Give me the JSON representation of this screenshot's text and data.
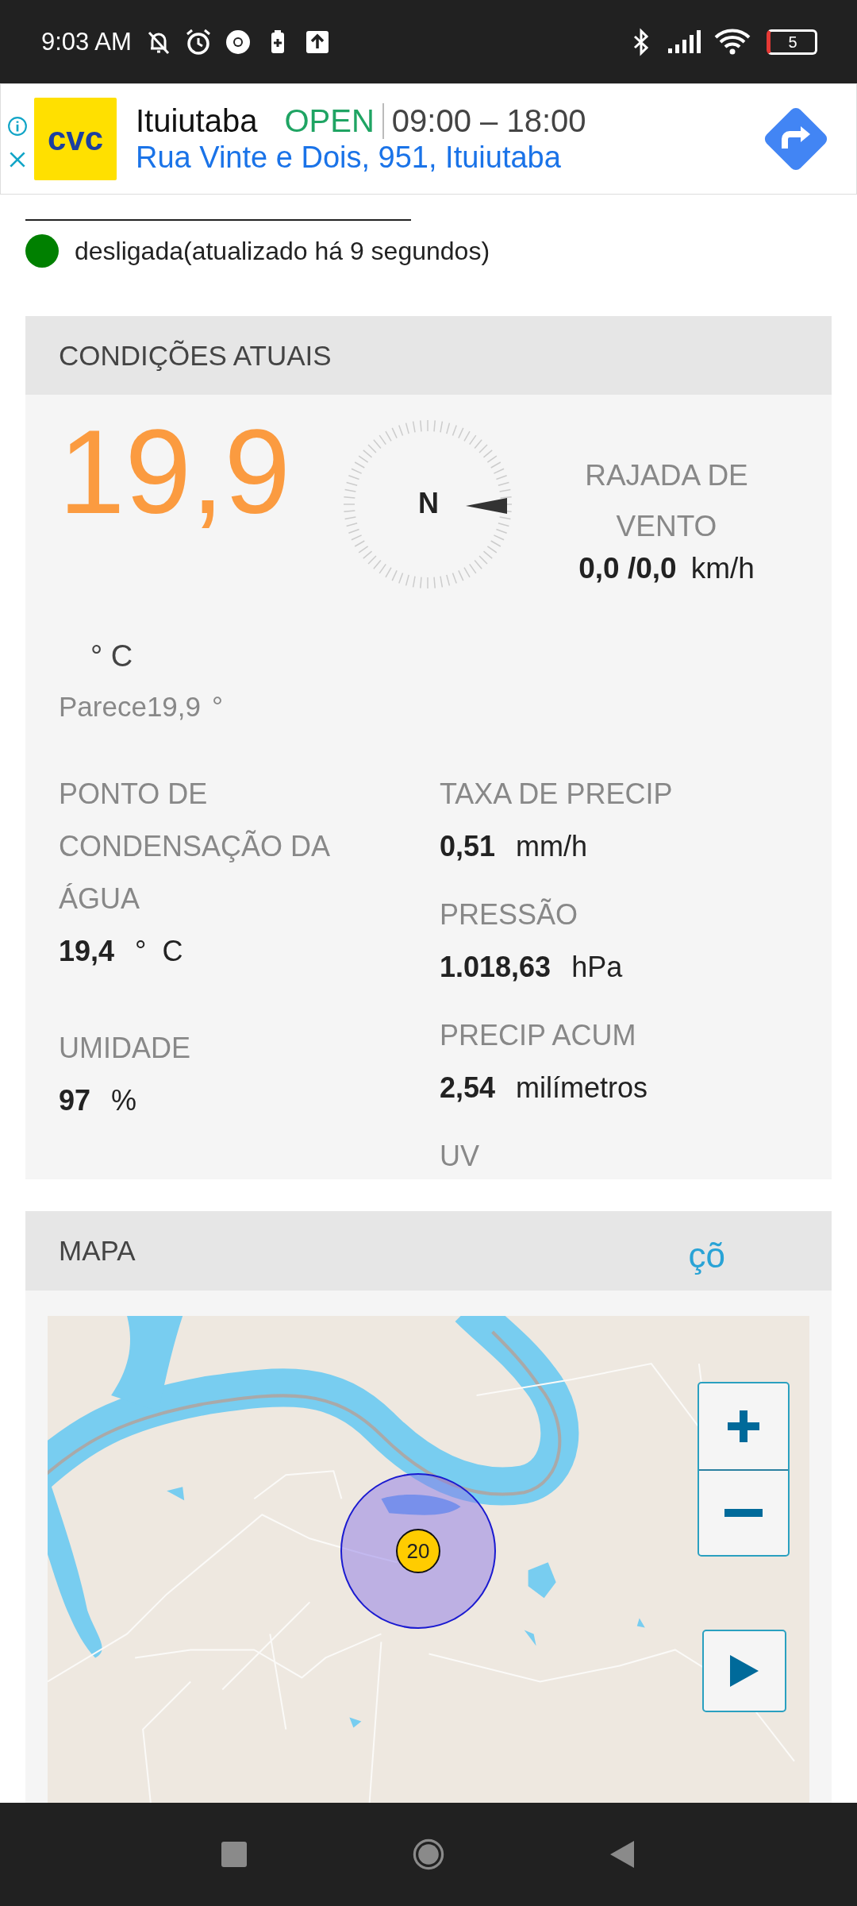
{
  "status_bar": {
    "time": "9:03 AM",
    "battery": "5"
  },
  "ad": {
    "logo": "cvc",
    "title": "Ituiutaba",
    "status": "OPEN",
    "hours": "09:00 – 18:00",
    "address": "Rua Vinte e Dois, 951, Ituiutaba"
  },
  "station": {
    "status": "desligada(atualizado há 9 segundos)",
    "color": "#008000"
  },
  "current": {
    "title": "CONDIÇÕES ATUAIS",
    "temperature": "19,9",
    "temp_unit": "° C",
    "feels_like": "Parece19,9",
    "feels_unit": "°",
    "compass_label": "N",
    "gust_label": "RAJADA DE VENTO",
    "gust_value": "0,0 /0,0",
    "gust_unit": "km/h",
    "stats_left": [
      {
        "label": "PONTO DE CONDENSAÇÃO DA ÁGUA",
        "value": "19,4",
        "unit": "°  C"
      },
      {
        "label": "UMIDADE",
        "value": "97",
        "unit": "%"
      }
    ],
    "stats_right": [
      {
        "label": "TAXA DE PRECIP",
        "value": "0,51",
        "unit": "mm/h"
      },
      {
        "label": "PRESSÃO",
        "value": "1.018,63",
        "unit": "hPa"
      },
      {
        "label": "PRECIP ACUM",
        "value": "2,54",
        "unit": "milímetros"
      },
      {
        "label": "UV"
      }
    ]
  },
  "map": {
    "title": "MAPA",
    "link": "çõ",
    "marker": "20"
  }
}
